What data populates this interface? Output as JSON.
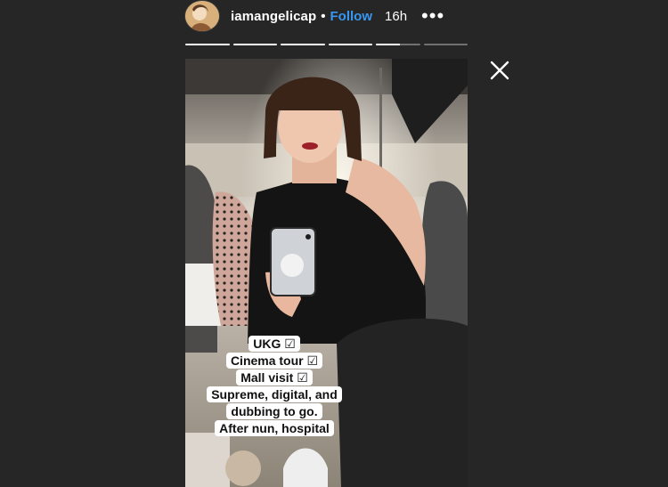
{
  "header": {
    "username": "iamangelicap",
    "separator": "•",
    "follow_label": "Follow",
    "time": "16h",
    "more_label": "•••"
  },
  "progress": {
    "segments": 6,
    "completed": 4,
    "current_fraction": 0.55
  },
  "story": {
    "captions": [
      "UKG ☑",
      "Cinema tour ☑",
      "Mall visit ☑",
      "Supreme, digital, and",
      "dubbing to go.",
      "After nun, hospital"
    ]
  },
  "icons": {
    "avatar": "profile-avatar",
    "close": "close-icon",
    "more": "more-options-icon"
  },
  "colors": {
    "background": "#262626",
    "follow": "#3897f0",
    "text": "#ffffff"
  }
}
